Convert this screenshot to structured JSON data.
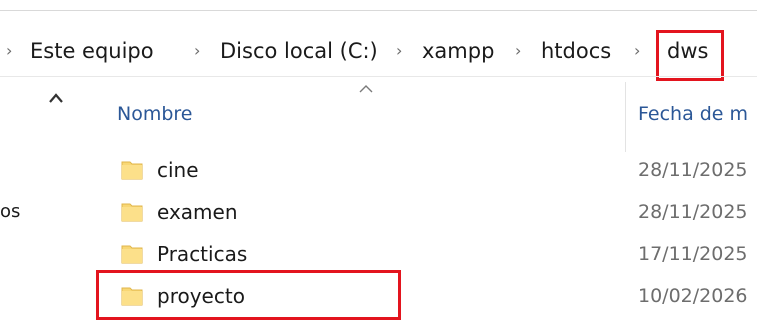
{
  "breadcrumb": {
    "items": [
      {
        "label": "Este equipo"
      },
      {
        "label": "Disco local (C:)"
      },
      {
        "label": "xampp"
      },
      {
        "label": "htdocs"
      },
      {
        "label": "dws"
      }
    ],
    "separator": "›"
  },
  "columns": {
    "name": "Nombre",
    "date": "Fecha de m"
  },
  "sidebar": {
    "partial_text": "os"
  },
  "files": [
    {
      "name": "cine",
      "date": "28/11/2025",
      "icon": "folder-icon"
    },
    {
      "name": "examen",
      "date": "28/11/2025",
      "icon": "folder-icon"
    },
    {
      "name": "Practicas",
      "date": "17/11/2025",
      "icon": "folder-icon"
    },
    {
      "name": "proyecto",
      "date": "10/02/2026",
      "icon": "folder-icon"
    }
  ],
  "colors": {
    "highlight": "#e3141e",
    "folder": "#f8d775",
    "header_text": "#2b5797"
  }
}
